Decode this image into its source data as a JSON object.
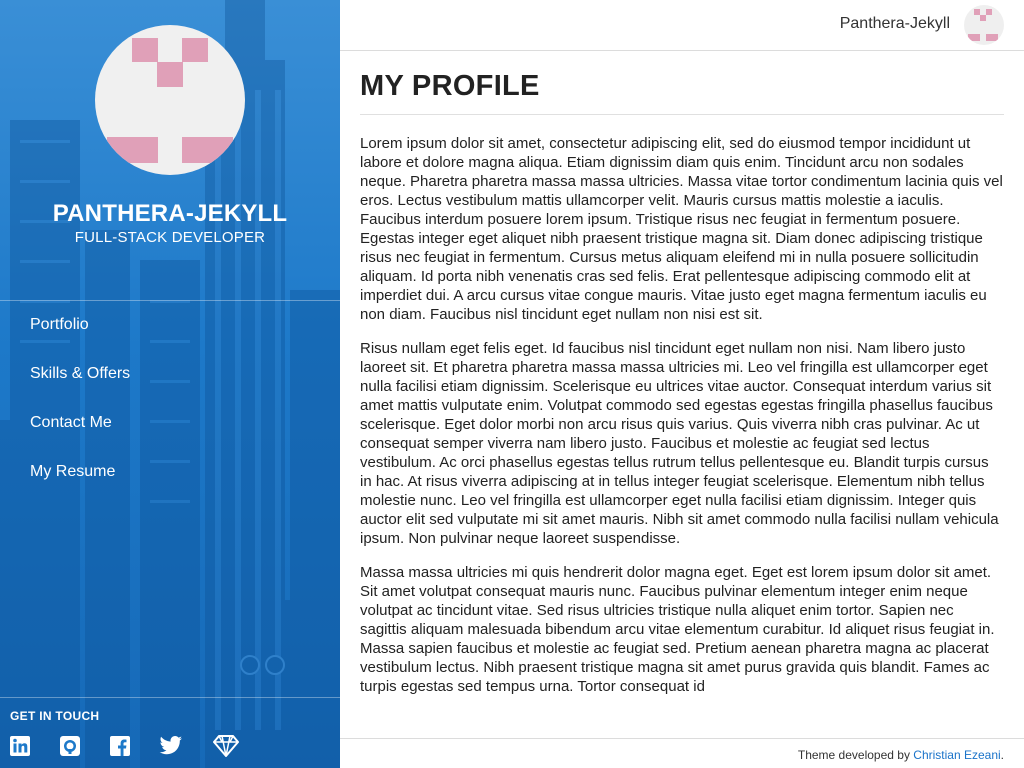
{
  "sidebar": {
    "name": "PANTHERA-JEKYLL",
    "role": "FULL-STACK DEVELOPER",
    "nav": [
      {
        "label": "Portfolio"
      },
      {
        "label": "Skills & Offers"
      },
      {
        "label": "Contact Me"
      },
      {
        "label": "My Resume"
      }
    ],
    "get_in_touch": "GET IN TOUCH",
    "social_icons": [
      "linkedin-icon",
      "github-icon",
      "facebook-icon",
      "twitter-icon",
      "gem-icon"
    ]
  },
  "topbar": {
    "username": "Panthera-Jekyll"
  },
  "main": {
    "title": "MY PROFILE",
    "paragraphs": [
      "Lorem ipsum dolor sit amet, consectetur adipiscing elit, sed do eiusmod tempor incididunt ut labore et dolore magna aliqua. Etiam dignissim diam quis enim. Tincidunt arcu non sodales neque. Pharetra pharetra massa massa ultricies. Massa vitae tortor condimentum lacinia quis vel eros. Lectus vestibulum mattis ullamcorper velit. Mauris cursus mattis molestie a iaculis. Faucibus interdum posuere lorem ipsum. Tristique risus nec feugiat in fermentum posuere. Egestas integer eget aliquet nibh praesent tristique magna sit. Diam donec adipiscing tristique risus nec feugiat in fermentum. Cursus metus aliquam eleifend mi in nulla posuere sollicitudin aliquam. Id porta nibh venenatis cras sed felis. Erat pellentesque adipiscing commodo elit at imperdiet dui. A arcu cursus vitae congue mauris. Vitae justo eget magna fermentum iaculis eu non diam. Faucibus nisl tincidunt eget nullam non nisi est sit.",
      "Risus nullam eget felis eget. Id faucibus nisl tincidunt eget nullam non nisi. Nam libero justo laoreet sit. Et pharetra pharetra massa massa ultricies mi. Leo vel fringilla est ullamcorper eget nulla facilisi etiam dignissim. Scelerisque eu ultrices vitae auctor. Consequat interdum varius sit amet mattis vulputate enim. Volutpat commodo sed egestas egestas fringilla phasellus faucibus scelerisque. Eget dolor morbi non arcu risus quis varius. Quis viverra nibh cras pulvinar. Ac ut consequat semper viverra nam libero justo. Faucibus et molestie ac feugiat sed lectus vestibulum. Ac orci phasellus egestas tellus rutrum tellus pellentesque eu. Blandit turpis cursus in hac. At risus viverra adipiscing at in tellus integer feugiat scelerisque. Elementum nibh tellus molestie nunc. Leo vel fringilla est ullamcorper eget nulla facilisi etiam dignissim. Integer quis auctor elit sed vulputate mi sit amet mauris. Nibh sit amet commodo nulla facilisi nullam vehicula ipsum. Non pulvinar neque laoreet suspendisse.",
      "Massa massa ultricies mi quis hendrerit dolor magna eget. Eget est lorem ipsum dolor sit amet. Sit amet volutpat consequat mauris nunc. Faucibus pulvinar elementum integer enim neque volutpat ac tincidunt vitae. Sed risus ultricies tristique nulla aliquet enim tortor. Sapien nec sagittis aliquam malesuada bibendum arcu vitae elementum curabitur. Id aliquet risus feugiat in. Massa sapien faucibus et molestie ac feugiat sed. Pretium aenean pharetra magna ac placerat vestibulum lectus. Nibh praesent tristique magna sit amet purus gravida quis blandit. Fames ac turpis egestas sed tempus urna. Tortor consequat id"
    ]
  },
  "footer": {
    "prefix": "Theme developed by",
    "author": "Christian Ezeani",
    "suffix": "."
  },
  "colors": {
    "sidebar_blue": "#1d79c9",
    "avatar_pink": "#e0a0b8",
    "link_blue": "#1a73c9"
  }
}
